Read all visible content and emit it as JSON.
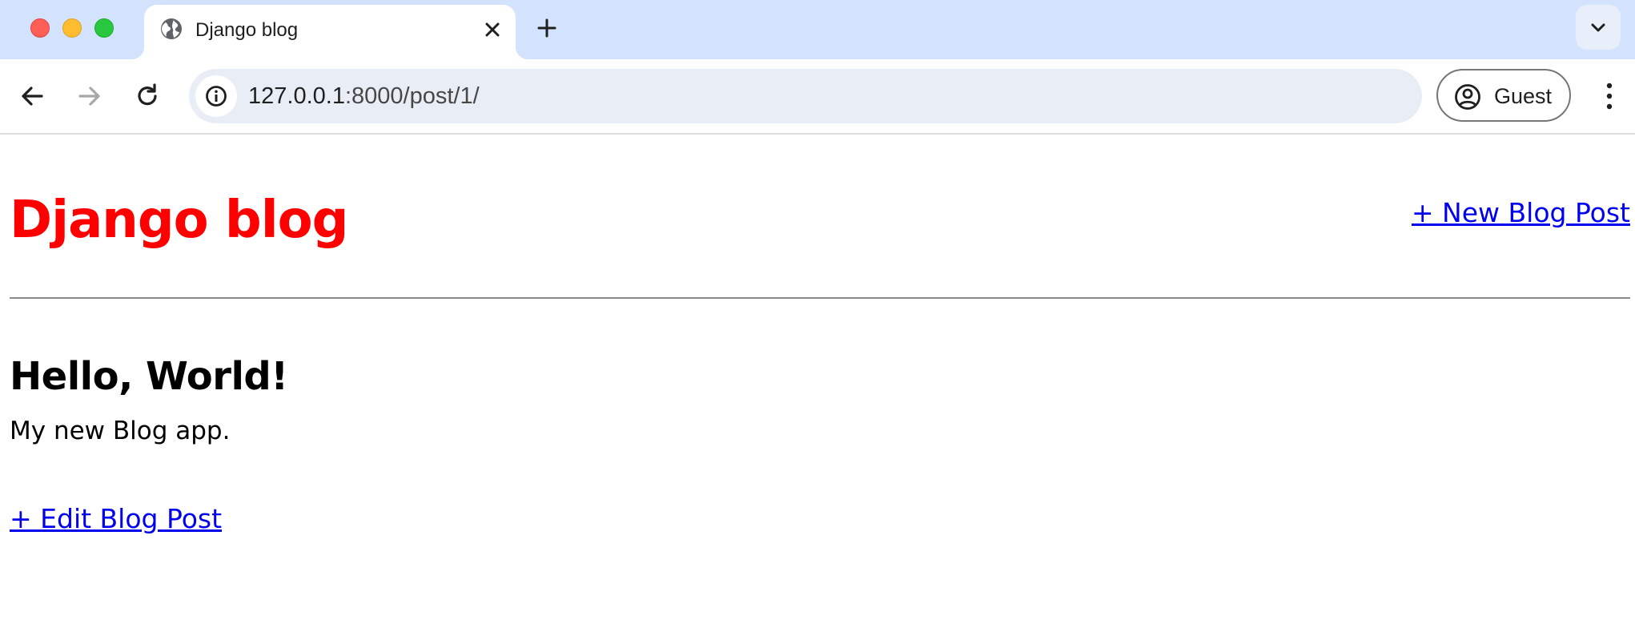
{
  "browser": {
    "tab": {
      "title": "Django blog",
      "favicon": "globe-icon"
    },
    "address": {
      "host": "127.0.0.1",
      "rest": ":8000/post/1/"
    },
    "profile": {
      "label": "Guest"
    },
    "colors": {
      "tabbar": "#d3e3fd",
      "omnibox": "#e9eef6"
    }
  },
  "page": {
    "site_title": "Django blog",
    "new_post_link": "+ New Blog Post",
    "post": {
      "title": "Hello, World!",
      "body": "My new Blog app."
    },
    "edit_post_link": "+ Edit Blog Post",
    "colors": {
      "site_title": "#ff0000",
      "link": "#0000ee"
    }
  }
}
